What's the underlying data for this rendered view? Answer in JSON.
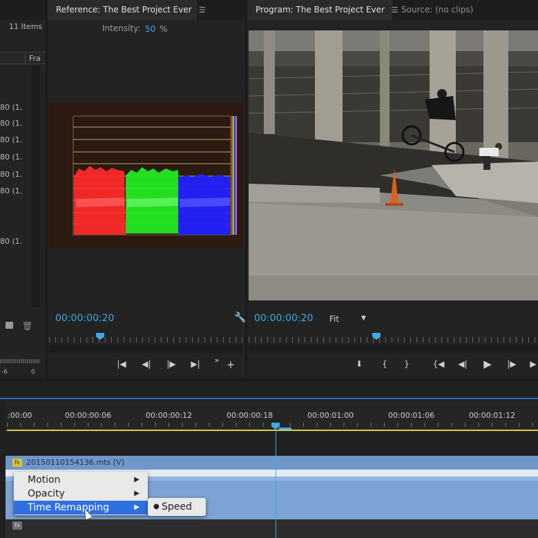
{
  "project_panel": {
    "items_count": "11 Items",
    "column_header": "Fra",
    "rows": [
      "80 (1.",
      "80 (1.",
      "80 (1.",
      "80 (1.",
      "80 (1.",
      "80 (1.",
      "80 (1."
    ],
    "meter_labels": [
      "-6",
      "0"
    ]
  },
  "reference_monitor": {
    "tab_title": "Reference: The Best Project Ever",
    "intensity_label": "Intensity:",
    "intensity_value": "50",
    "intensity_unit": "%",
    "timecode": "00:00:00:20"
  },
  "program_monitor": {
    "tab_title": "Program: The Best Project Ever",
    "source_tab": "Source: (no clips)",
    "timecode": "00:00:00:20",
    "zoom_value": "Fit"
  },
  "timeline": {
    "ruler_labels": [
      ":00:00",
      "00:00:00:06",
      "00:00:00:12",
      "00:00:00:18",
      "00:00:01:00",
      "00:00:01:06",
      "00:00:01:12"
    ],
    "clip_name": "20150110154136.mts [V]",
    "fx_badge": "fx"
  },
  "context_menu": {
    "items": [
      "Motion",
      "Opacity",
      "Time Remapping"
    ],
    "submenu_item": "Speed"
  },
  "colors": {
    "accent": "#3ea8e8",
    "clip": "#7ba3d4",
    "selection": "#2f6fe0"
  }
}
